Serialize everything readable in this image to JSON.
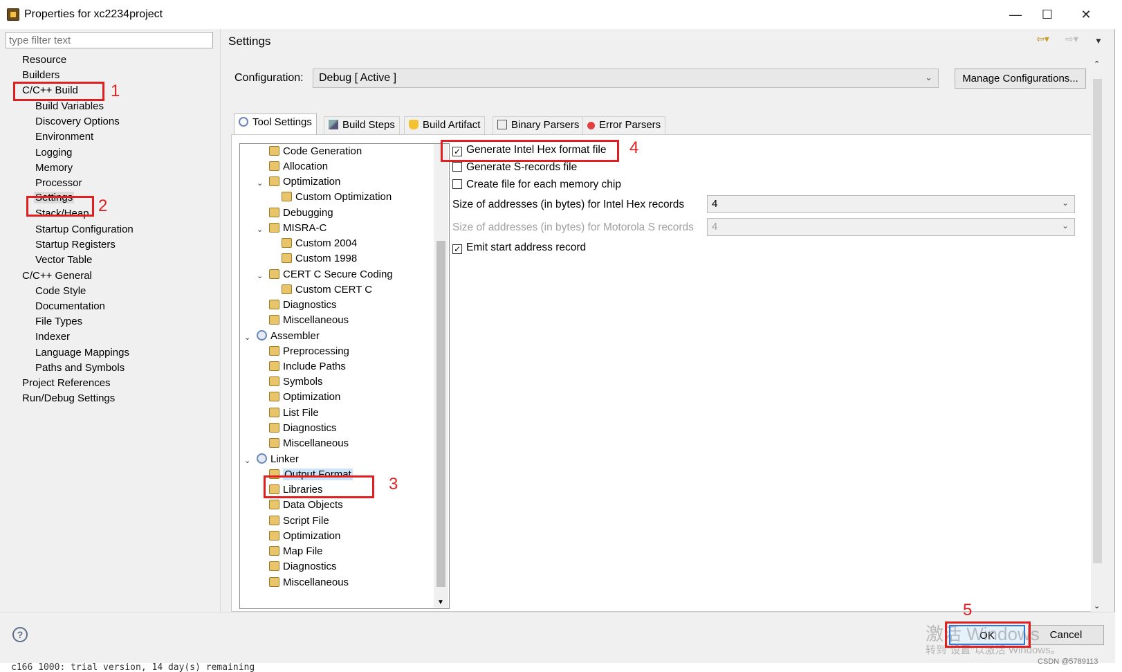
{
  "window": {
    "title": "Properties for xc2234project",
    "minimize": "—",
    "maximize": "☐",
    "close": "✕"
  },
  "filter": {
    "placeholder": "type filter text"
  },
  "nav": {
    "items": [
      "Resource",
      "Builders",
      "C/C++ Build",
      "Build Variables",
      "Discovery Options",
      "Environment",
      "Logging",
      "Memory",
      "Processor",
      "Settings",
      "Stack/Heap",
      "Startup Configuration",
      "Startup Registers",
      "Vector Table",
      "C/C++ General",
      "Code Style",
      "Documentation",
      "File Types",
      "Indexer",
      "Language Mappings",
      "Paths and Symbols",
      "Project References",
      "Run/Debug Settings"
    ]
  },
  "page": {
    "title": "Settings",
    "config_label": "Configuration:",
    "config_value": "Debug  [ Active ]",
    "manage_button": "Manage Configurations..."
  },
  "tabs": [
    "Tool Settings",
    "Build Steps",
    "Build Artifact",
    "Binary Parsers",
    "Error Parsers"
  ],
  "tool_tree": {
    "items": [
      "Code Generation",
      "Allocation",
      "Optimization",
      "Custom Optimization",
      "Debugging",
      "MISRA-C",
      "Custom 2004",
      "Custom 1998",
      "CERT C Secure Coding",
      "Custom CERT C",
      "Diagnostics",
      "Miscellaneous",
      "Assembler",
      "Preprocessing",
      "Include Paths",
      "Symbols",
      "Optimization",
      "List File",
      "Diagnostics",
      "Miscellaneous",
      "Linker",
      "Output Format",
      "Libraries",
      "Data Objects",
      "Script File",
      "Optimization",
      "Map File",
      "Diagnostics",
      "Miscellaneous"
    ]
  },
  "options": {
    "hex": {
      "label": "Generate Intel Hex format file",
      "checked": true
    },
    "srec": {
      "label": "Generate S-records file",
      "checked": false
    },
    "perchip": {
      "label": "Create file for each memory chip",
      "checked": false
    },
    "hex_size_label": "Size of addresses (in bytes) for Intel Hex records",
    "hex_size_value": "4",
    "srec_size_label": "Size of addresses (in bytes) for Motorola S records",
    "srec_size_value": "4",
    "emit": {
      "label": "Emit start address record",
      "checked": true
    },
    "check_mark": "✓"
  },
  "footer": {
    "help": "?",
    "ok": "OK",
    "cancel": "Cancel",
    "watermark_line1": "激活 Windows",
    "watermark_line2": "转到\"设置\"以激活 Windows。",
    "csdn": "CSDN @5789113"
  },
  "console": {
    "line": "c166 1000: trial version, 14 day(s) remaining"
  },
  "annotations": [
    "1",
    "2",
    "3",
    "4",
    "5"
  ],
  "colors": {
    "annotation": "#e02020",
    "selection": "#cce4f7",
    "ok_border": "#2a7ad9"
  }
}
